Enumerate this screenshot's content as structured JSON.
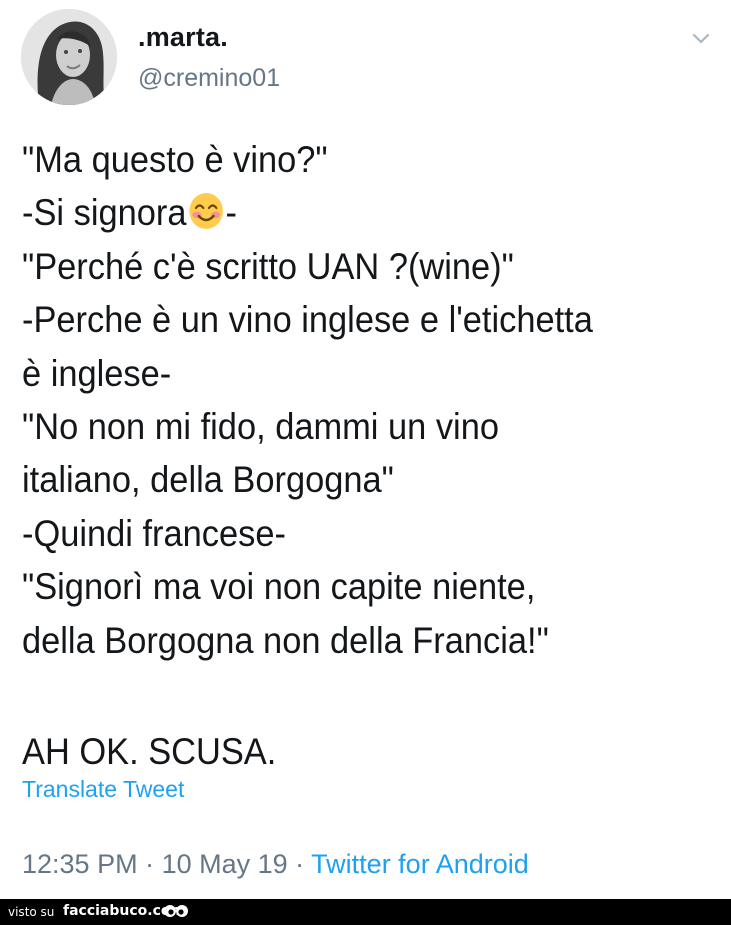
{
  "user": {
    "display_name": ".marta.",
    "handle": "@cremino01"
  },
  "tweet": {
    "line_1": "\"Ma questo è vino?\"",
    "line_2_before": "-Si signora",
    "line_2_emoji": "smiling-face-with-smiling-eyes-icon",
    "line_2_after": "-",
    "line_3": "\"Perché c'è scritto UAN ?(wine)\"",
    "line_4": "-Perche è un vino inglese e l'etichetta",
    "line_5": "è inglese-",
    "line_6": "\"No non mi fido, dammi un vino",
    "line_7": "italiano, della Borgogna\"",
    "line_8": "-Quindi francese-",
    "line_9": "\"Signorì ma voi non capite niente,",
    "line_10": "della Borgogna non della Francia!\"",
    "line_12": "AH OK. SCUSA."
  },
  "actions": {
    "translate_label": "Translate Tweet"
  },
  "meta": {
    "time": "12:35 PM",
    "separator": " · ",
    "date": "10 May 19",
    "source": "Twitter for Android"
  },
  "footer": {
    "visto_su": "visto su",
    "site": "facciabuco.com"
  },
  "colors": {
    "text": "#14171a",
    "secondary": "#657786",
    "link": "#1da1f2",
    "footer_bg": "#000000"
  }
}
